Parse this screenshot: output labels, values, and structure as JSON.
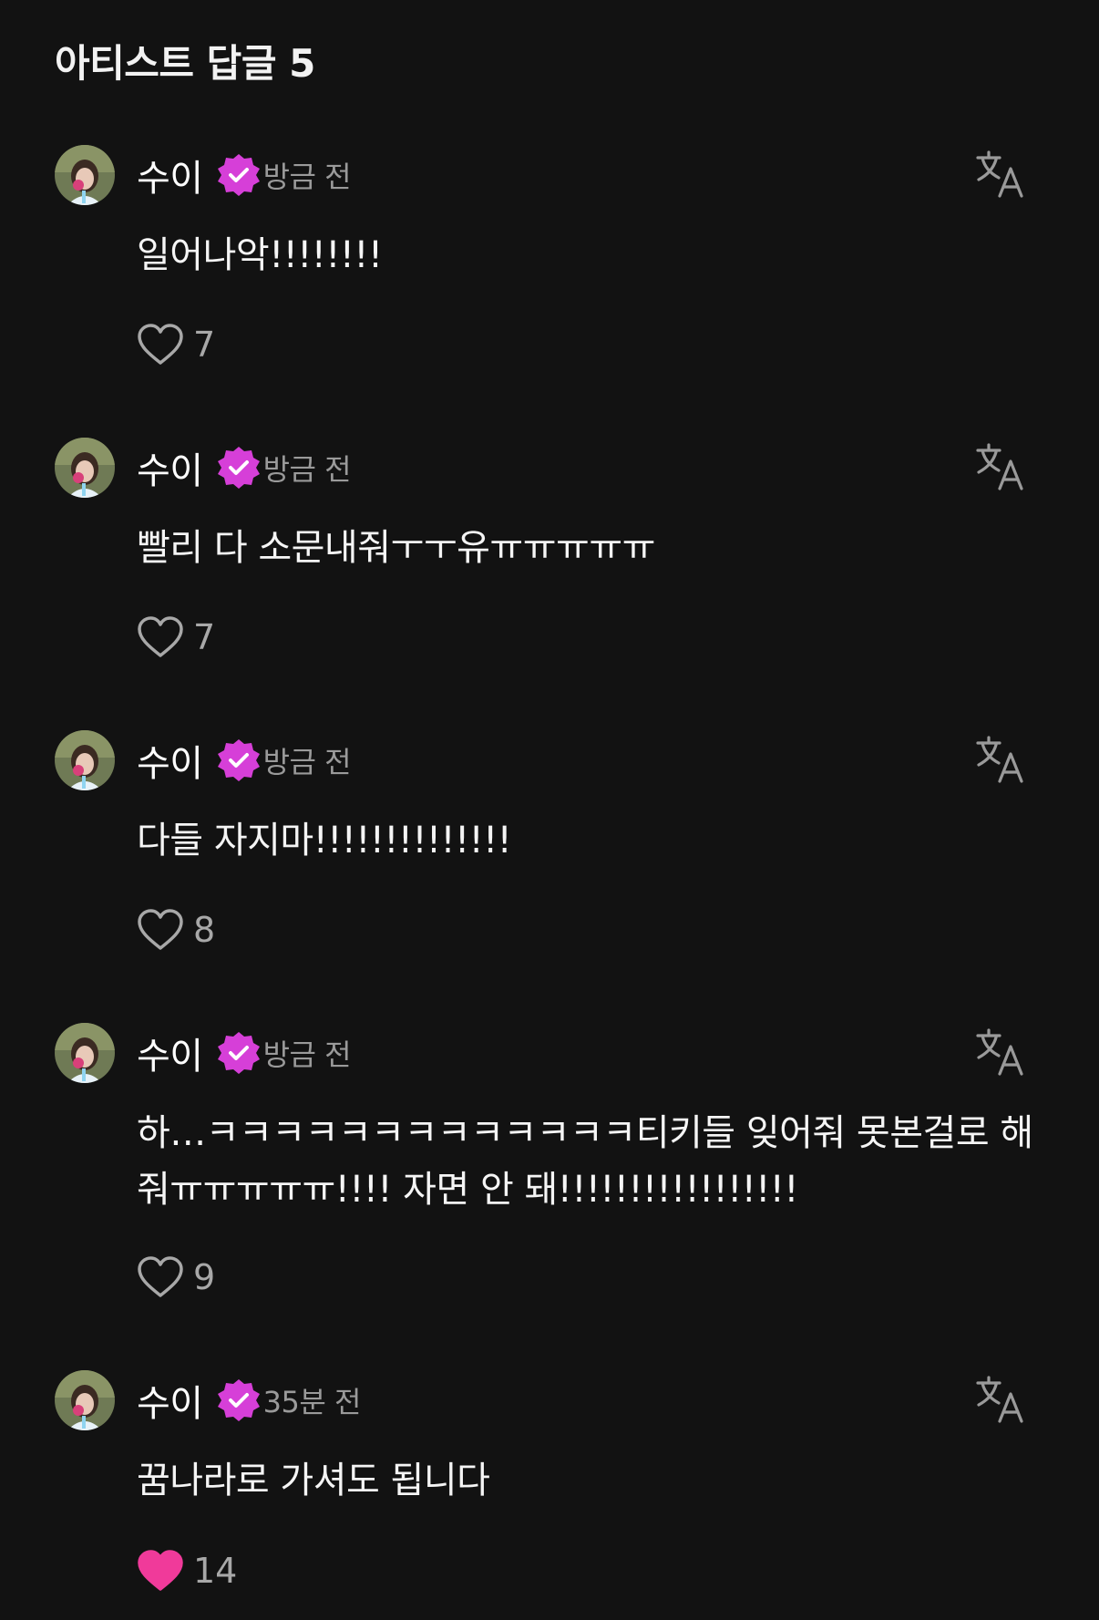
{
  "section": {
    "title": "아티스트 답글 5"
  },
  "colors": {
    "background": "#121212",
    "verified_badge": "#d63fd8",
    "liked_heart": "#f03a9a",
    "muted_text": "#9a9a9a"
  },
  "replies": [
    {
      "author": "수이",
      "time": "방금 전",
      "text": "일어나악!!!!!!!!",
      "likes": "7",
      "liked": false
    },
    {
      "author": "수이",
      "time": "방금 전",
      "text": "빨리 다 소문내줘ㅜㅜ유ㅠㅠㅠㅠㅠ",
      "likes": "7",
      "liked": false
    },
    {
      "author": "수이",
      "time": "방금 전",
      "text": "다들 자지마!!!!!!!!!!!!!!",
      "likes": "8",
      "liked": false
    },
    {
      "author": "수이",
      "time": "방금 전",
      "text": "하…ㅋㅋㅋㅋㅋㅋㅋㅋㅋㅋㅋㅋㅋ티키들 잊어줘 못본걸로 해줘ㅠㅠㅠㅠㅠ!!!! 자면 안 돼!!!!!!!!!!!!!!!!!",
      "likes": "9",
      "liked": false
    },
    {
      "author": "수이",
      "time": "35분 전",
      "text": "꿈나라로 가셔도 됩니다",
      "likes": "14",
      "liked": true
    }
  ],
  "icons": {
    "verified": "verified-badge-icon",
    "translate": "translate-icon",
    "like": "heart-icon"
  }
}
